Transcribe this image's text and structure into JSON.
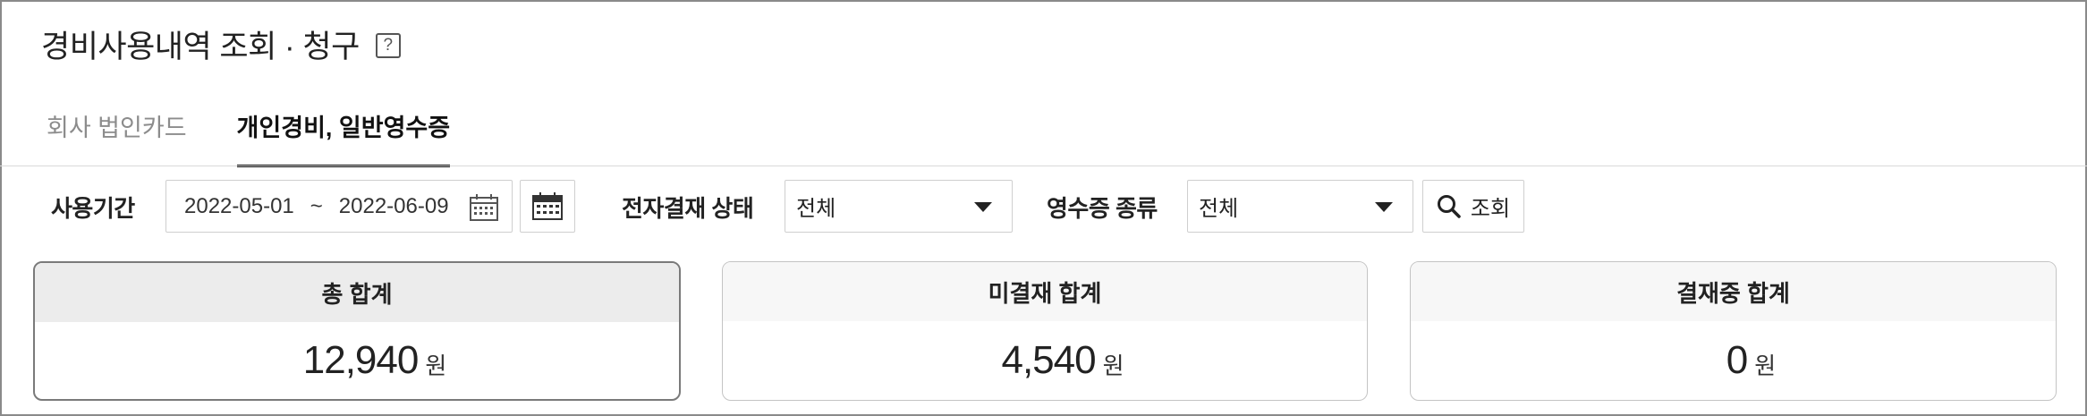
{
  "page": {
    "title": "경비사용내역 조회 · 청구",
    "help_icon_glyph": "?"
  },
  "tabs": [
    {
      "label": "회사 법인카드",
      "active": false
    },
    {
      "label": "개인경비, 일반영수증",
      "active": true
    }
  ],
  "filters": {
    "period_label": "사용기간",
    "start_date": "2022-05-01",
    "separator": "~",
    "end_date": "2022-06-09",
    "approval_status_label": "전자결재 상태",
    "approval_status_value": "전체",
    "receipt_type_label": "영수증 종류",
    "receipt_type_value": "전체",
    "search_label": "조회"
  },
  "summary": [
    {
      "title": "총 합계",
      "value": "12,940",
      "unit": "원",
      "selected": true
    },
    {
      "title": "미결재 합계",
      "value": "4,540",
      "unit": "원",
      "selected": false
    },
    {
      "title": "결재중 합계",
      "value": "0",
      "unit": "원",
      "selected": false
    }
  ],
  "icons": {
    "calendar": "calendar-icon",
    "search": "search-icon",
    "dropdown": "chevron-down-icon",
    "help": "help-icon"
  },
  "colors": {
    "active_tab": "#111111",
    "inactive_tab": "#8c8c8c",
    "card_header_bg": "#f7f7f7",
    "selected_card_header_bg": "#ececec"
  }
}
